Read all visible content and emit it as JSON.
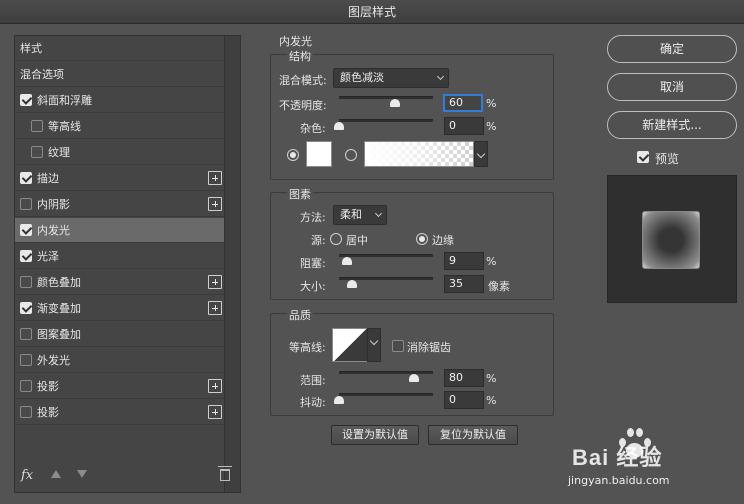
{
  "window": {
    "title": "图层样式"
  },
  "styles_panel": {
    "items": [
      {
        "label": "样式",
        "checkbox": false,
        "checked": false,
        "plus": false,
        "indent": 0,
        "selected": false
      },
      {
        "label": "混合选项",
        "checkbox": false,
        "checked": false,
        "plus": false,
        "indent": 0,
        "selected": false
      },
      {
        "label": "斜面和浮雕",
        "checkbox": true,
        "checked": true,
        "plus": false,
        "indent": 0,
        "selected": false
      },
      {
        "label": "等高线",
        "checkbox": true,
        "checked": false,
        "plus": false,
        "indent": 1,
        "selected": false
      },
      {
        "label": "纹理",
        "checkbox": true,
        "checked": false,
        "plus": false,
        "indent": 1,
        "selected": false
      },
      {
        "label": "描边",
        "checkbox": true,
        "checked": true,
        "plus": true,
        "indent": 0,
        "selected": false
      },
      {
        "label": "内阴影",
        "checkbox": true,
        "checked": false,
        "plus": true,
        "indent": 0,
        "selected": false
      },
      {
        "label": "内发光",
        "checkbox": true,
        "checked": true,
        "plus": false,
        "indent": 0,
        "selected": true
      },
      {
        "label": "光泽",
        "checkbox": true,
        "checked": true,
        "plus": false,
        "indent": 0,
        "selected": false
      },
      {
        "label": "颜色叠加",
        "checkbox": true,
        "checked": false,
        "plus": true,
        "indent": 0,
        "selected": false
      },
      {
        "label": "渐变叠加",
        "checkbox": true,
        "checked": true,
        "plus": true,
        "indent": 0,
        "selected": false
      },
      {
        "label": "图案叠加",
        "checkbox": true,
        "checked": false,
        "plus": false,
        "indent": 0,
        "selected": false
      },
      {
        "label": "外发光",
        "checkbox": true,
        "checked": false,
        "plus": false,
        "indent": 0,
        "selected": false
      },
      {
        "label": "投影",
        "checkbox": true,
        "checked": false,
        "plus": true,
        "indent": 0,
        "selected": false
      },
      {
        "label": "投影",
        "checkbox": true,
        "checked": false,
        "plus": true,
        "indent": 0,
        "selected": false
      }
    ],
    "footer": {
      "fx_label": "fx"
    }
  },
  "inner_glow": {
    "section_title": "内发光",
    "structure": {
      "title": "结构",
      "blend_mode_label": "混合模式:",
      "blend_mode_value": "颜色减淡",
      "opacity_label": "不透明度:",
      "opacity_value": "60",
      "opacity_unit": "%",
      "opacity_level": 60,
      "noise_label": "杂色:",
      "noise_value": "0",
      "noise_unit": "%",
      "noise_level": 0
    },
    "elements": {
      "title": "图素",
      "technique_label": "方法:",
      "technique_value": "柔和",
      "source_label": "源:",
      "source_center": "居中",
      "source_edge": "边缘",
      "choke_label": "阻塞:",
      "choke_value": "9",
      "choke_unit": "%",
      "choke_level": 9,
      "size_label": "大小:",
      "size_value": "35",
      "size_unit": "像素",
      "size_level": 14
    },
    "quality": {
      "title": "品质",
      "contour_label": "等高线:",
      "antialias_label": "消除锯齿",
      "range_label": "范围:",
      "range_value": "80",
      "range_unit": "%",
      "range_level": 80,
      "jitter_label": "抖动:",
      "jitter_value": "0",
      "jitter_unit": "%",
      "jitter_level": 0
    },
    "buttons": {
      "make_default": "设置为默认值",
      "reset_default": "复位为默认值"
    }
  },
  "actions": {
    "ok": "确定",
    "cancel": "取消",
    "new_style": "新建样式...",
    "preview_label": "预览"
  },
  "watermark": {
    "brand": "Bai  经验",
    "url": "jingyan.baidu.com"
  },
  "colors": {
    "focus_ring": "#2f7fd8",
    "selected_row": "#6a6a6a",
    "panel_bg": "#535353"
  }
}
